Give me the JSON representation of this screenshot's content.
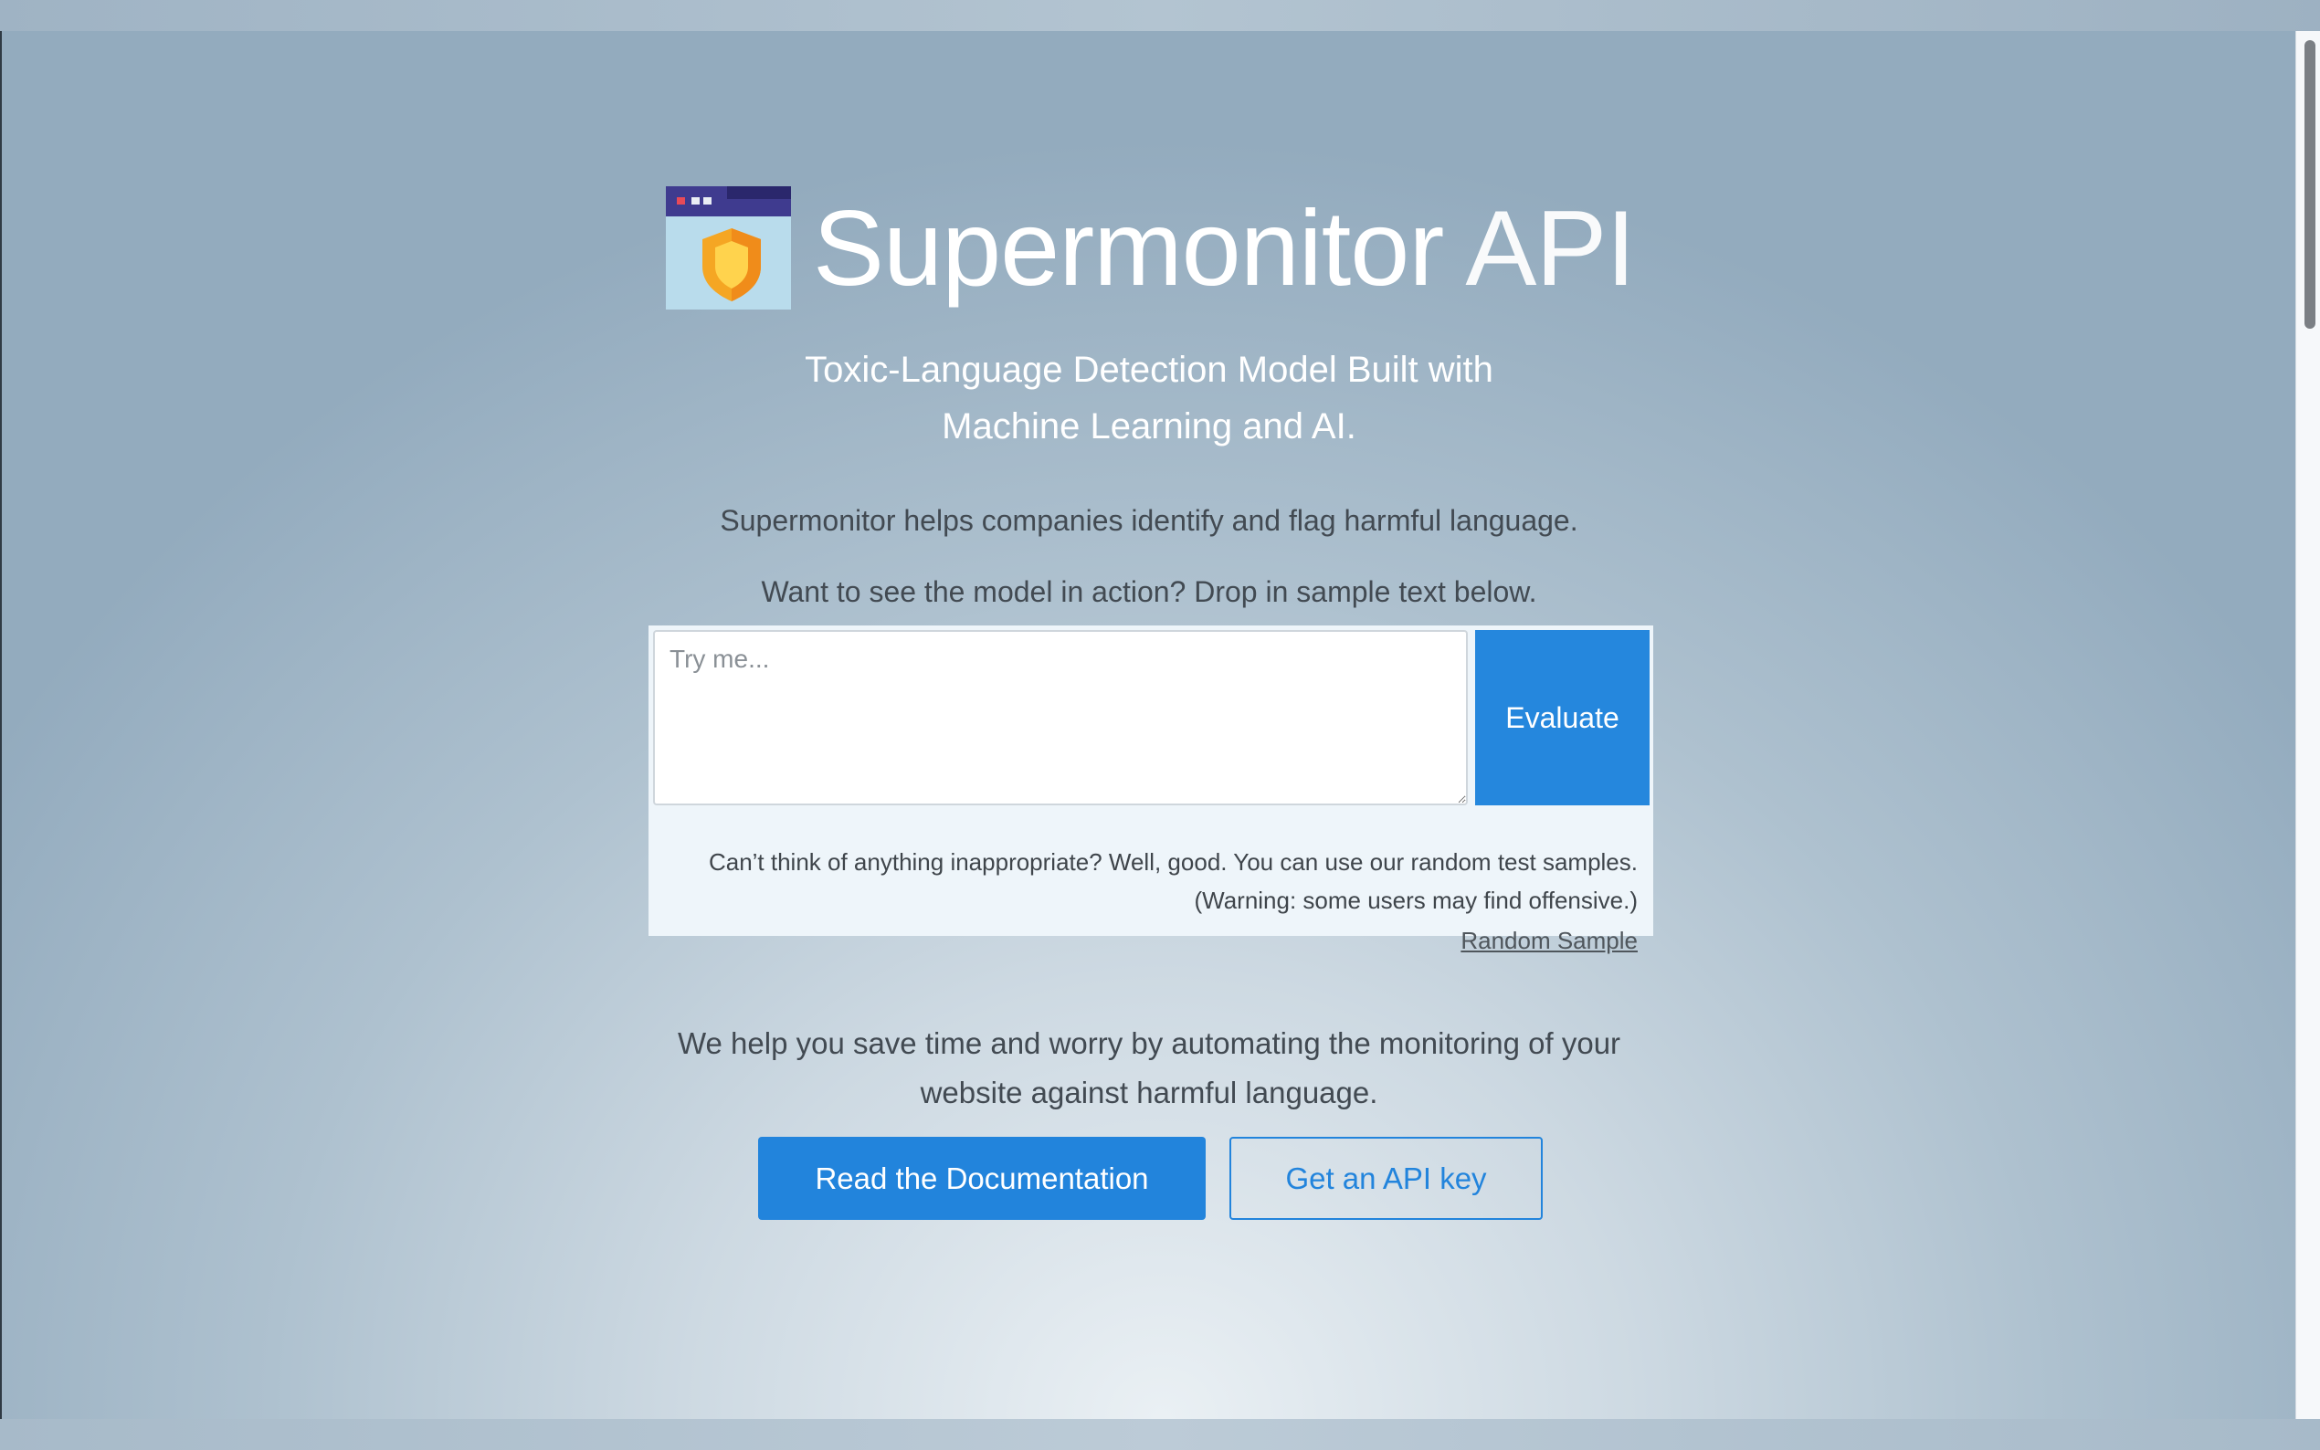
{
  "brand": {
    "name": "Supermonitor",
    "suffix": "API",
    "logo_icon": "browser-shield-icon"
  },
  "hero": {
    "headline_line1": "Toxic-Language Detection Model Built with",
    "headline_line2": "Machine Learning and AI.",
    "description": "Supermonitor helps companies identify and flag harmful language.",
    "prompt": "Want to see the model in action? Drop in sample text below."
  },
  "try_it": {
    "placeholder": "Try me...",
    "evaluate_label": "Evaluate",
    "note_line1": "Can’t think of anything inappropriate? Well, good. You can use our random test samples.",
    "note_line2": "(Warning: some users may find offensive.)",
    "random_sample_label": "Random Sample"
  },
  "pitch": {
    "line1": "We help you save time and worry by automating the monitoring of your",
    "line2": "website against harmful language."
  },
  "cta": {
    "docs_label": "Read the Documentation",
    "api_key_label": "Get an API key"
  },
  "colors": {
    "accent": "#2284dc",
    "logo_bar": "#3f3b8f",
    "logo_shield": "#f5a623"
  }
}
